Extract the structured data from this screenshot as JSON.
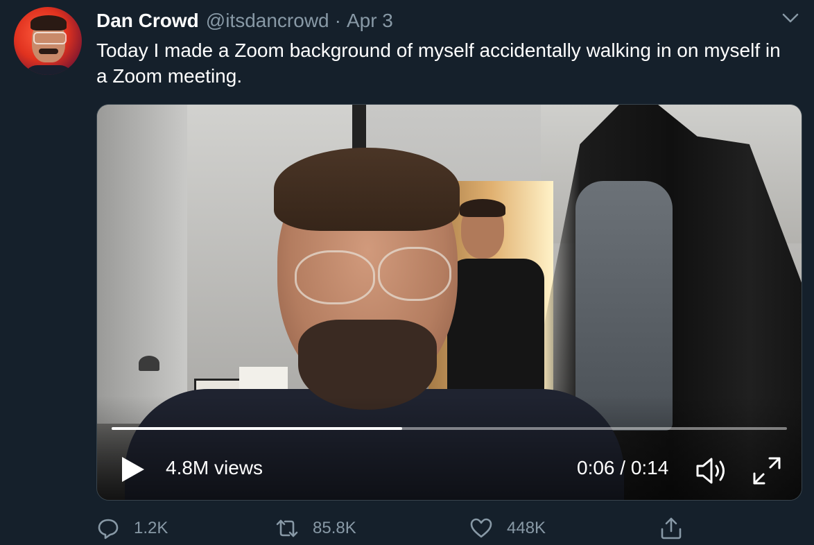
{
  "tweet": {
    "author_name": "Dan Crowd",
    "author_handle": "@itsdancrowd",
    "separator": "·",
    "date": "Apr 3",
    "text": "Today I made a Zoom background of myself accidentally walking in on myself in a Zoom meeting."
  },
  "video": {
    "views": "4.8M views",
    "time": "0:06 / 0:14",
    "progress_fraction": 0.43
  },
  "actions": {
    "reply_count": "1.2K",
    "retweet_count": "85.8K",
    "like_count": "448K"
  },
  "icons": {
    "menu": "chevron-down-icon",
    "play": "play-icon",
    "volume": "volume-icon",
    "fullscreen": "fullscreen-icon",
    "reply": "reply-icon",
    "retweet": "retweet-icon",
    "like": "heart-icon",
    "share": "share-icon"
  },
  "colors": {
    "background": "#15202b",
    "secondary_text": "#8899a6",
    "primary_text": "#ffffff"
  }
}
